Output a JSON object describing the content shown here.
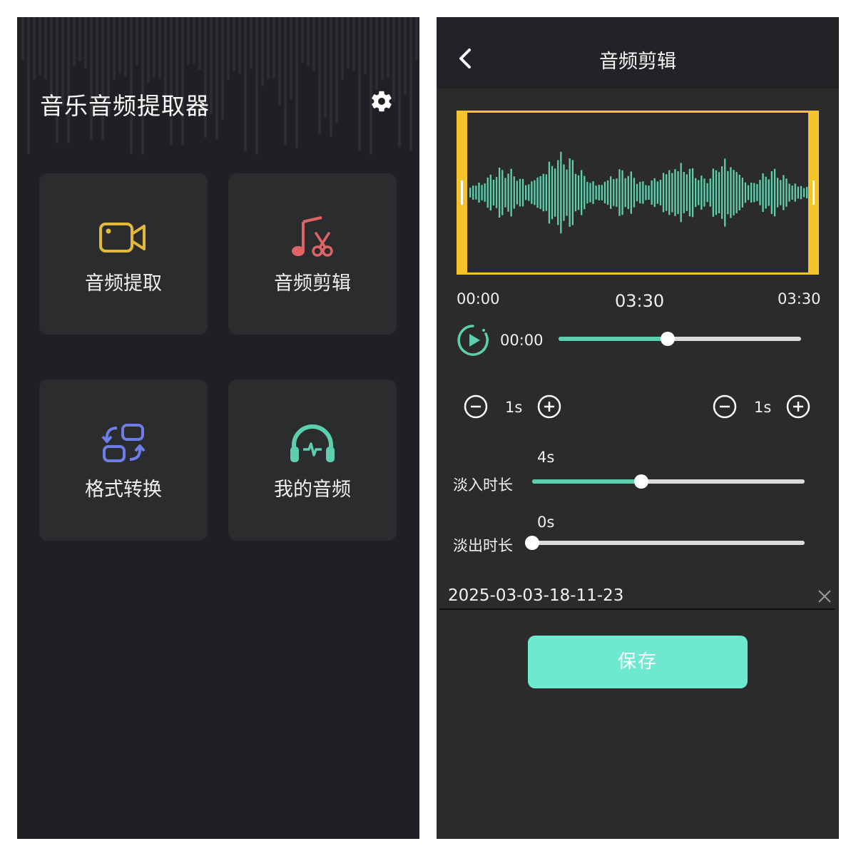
{
  "home": {
    "title": "音乐音频提取器",
    "cards": [
      {
        "label": "音频提取",
        "icon": "video-camera-icon",
        "color": "#e3b93c"
      },
      {
        "label": "音频剪辑",
        "icon": "music-scissors-icon",
        "color": "#e06467"
      },
      {
        "label": "格式转换",
        "icon": "convert-icon",
        "color": "#6f7de8"
      },
      {
        "label": "我的音频",
        "icon": "headphones-icon",
        "color": "#5ecfad"
      }
    ],
    "settings_icon": "gear-icon"
  },
  "editor": {
    "title": "音频剪辑",
    "time_start": "00:00",
    "time_duration": "03:30",
    "time_end": "03:30",
    "current_time": "00:00",
    "playback_progress": 0.45,
    "start_step": "1s",
    "end_step": "1s",
    "fade_in_label": "淡入时长",
    "fade_in_value": "4s",
    "fade_in_level": 0.4,
    "fade_out_label": "淡出时长",
    "fade_out_value": "0s",
    "fade_out_level": 0,
    "filename": "2025-03-03-18-11-23",
    "save_label": "保存"
  },
  "colors": {
    "accent": "#5ecfad",
    "selection": "#f5c32c",
    "save_button": "#6ee8ce"
  }
}
